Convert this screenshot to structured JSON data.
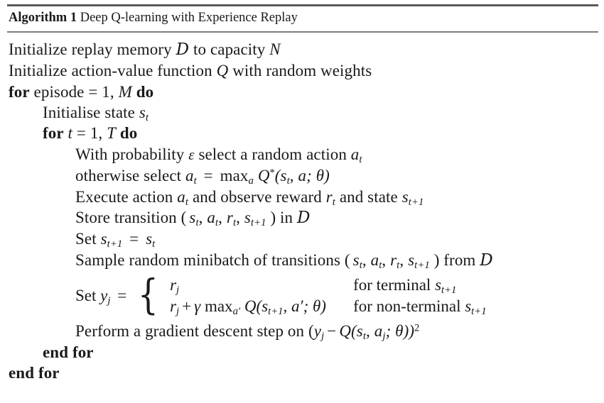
{
  "algorithm": {
    "label": "Algorithm 1",
    "title": "Deep Q-learning with Experience Replay",
    "lines": {
      "l1_a": "Initialize replay memory",
      "l1_b": "to capacity",
      "l1_mem": "D",
      "l1_cap": "N",
      "l2_a": "Initialize action-value function",
      "l2_q": "Q",
      "l2_b": "with random weights",
      "l3_for": "for",
      "l3_a": "episode",
      "l3_eq": "=",
      "l3_one": "1,",
      "l3_m": "M",
      "l3_do": "do",
      "l4_a": "Initialise  state",
      "l4_s": "s",
      "l4_sub": "t",
      "l5_for": "for",
      "l5_t": "t",
      "l5_eq": "=",
      "l5_one": "1,",
      "l5_T": "T",
      "l5_do": "do",
      "l6_a": "With probability",
      "l6_eps": "ε",
      "l6_b": "select a random action",
      "l6_a_t": "a",
      "l6_sub": "t",
      "l7_a": "otherwise select",
      "l7_at": "a",
      "l7_atsub": "t",
      "l7_eq": "=",
      "l7_max": "max",
      "l7_maxsub": "a",
      "l7_q": "Q",
      "l7_star": "*",
      "l7_args": "(s",
      "l7_argsub": "t",
      "l7_argmid": ", a; θ)",
      "l8_a": "Execute action",
      "l8_at": "a",
      "l8_atsub": "t",
      "l8_b": "and observe reward",
      "l8_r": "r",
      "l8_rsub": "t",
      "l8_c": "and state",
      "l8_s": "s",
      "l8_ssub": "t+1",
      "l9_a": "Store transition (",
      "l9_tuple_s": "s",
      "l9_tuple_ssub": "t",
      "l9_tuple_a": "a",
      "l9_tuple_asub": "t",
      "l9_tuple_r": "r",
      "l9_tuple_rsub": "t",
      "l9_tuple_s2": "s",
      "l9_tuple_s2sub": "t+1",
      "l9_b": ") in",
      "l9_mem": "D",
      "l10_set": "Set",
      "l10_s1": "s",
      "l10_s1sub": "t+1",
      "l10_eq": "=",
      "l10_s2": "s",
      "l10_s2sub": "t",
      "l11_a": "Sample random minibatch of transitions (",
      "l11_b": ")  from",
      "l11_mem": "D",
      "l12_set": "Set",
      "l12_y": "y",
      "l12_ysub": "j",
      "l12_eq": "=",
      "l12_case1_expr": "r",
      "l12_case1_sub": "j",
      "l12_case1_cond": "for terminal",
      "l12_case1_cond_s": "s",
      "l12_case1_cond_sub": "t+1",
      "l12_case2_r": "r",
      "l12_case2_rsub": "j",
      "l12_case2_plus": "+",
      "l12_case2_gamma": "γ",
      "l12_case2_max": "max",
      "l12_case2_maxsub": "a′",
      "l12_case2_q": "Q",
      "l12_case2_args_open": "(s",
      "l12_case2_args_sub": "t+1",
      "l12_case2_args_rest": ", a′; θ)",
      "l12_case2_cond": "for non-terminal",
      "l12_case2_cond_s": "s",
      "l12_case2_cond_sub": "t+1",
      "l13_a": "Perform a gradient descent step on (",
      "l13_y": "y",
      "l13_ysub": "j",
      "l13_minus": "−",
      "l13_q": "Q",
      "l13_qopen": "(s",
      "l13_qsub": "t",
      "l13_qmid": ", a",
      "l13_qsub2": "j",
      "l13_qend": "; θ))",
      "l13_pow": "2",
      "l14_endfor": "end for",
      "l15_endfor": "end for"
    }
  }
}
